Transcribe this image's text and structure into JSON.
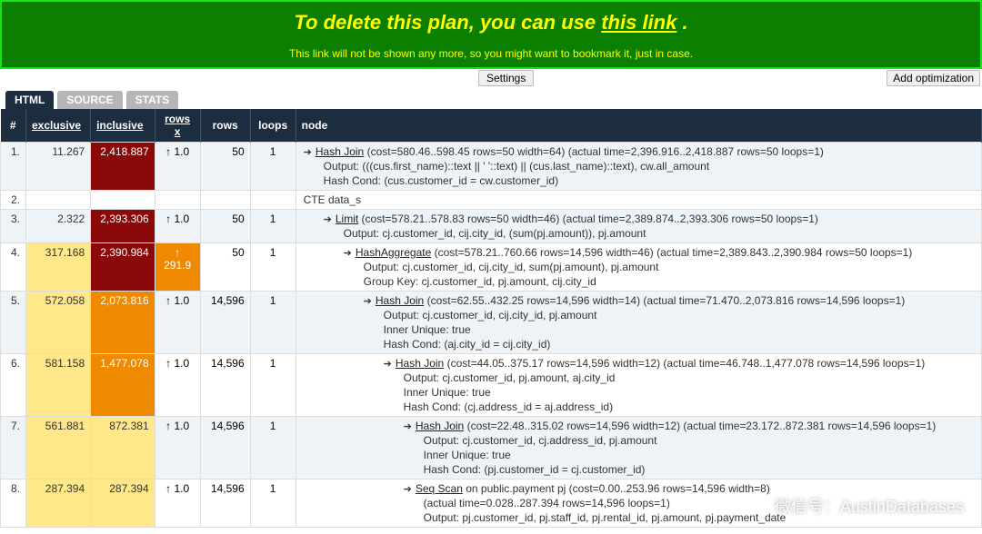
{
  "banner": {
    "title_pre": "To delete this plan, you can use ",
    "title_link": "this link",
    "title_post": ".",
    "note": "This link will not be shown any more, so you might want to bookmark it, just in case."
  },
  "buttons": {
    "settings": "Settings",
    "add_opt": "Add optimization"
  },
  "tabs": [
    {
      "label": "HTML",
      "active": true
    },
    {
      "label": "SOURCE",
      "active": false
    },
    {
      "label": "STATS",
      "active": false
    }
  ],
  "headers": {
    "idx": "#",
    "exclusive": "exclusive",
    "inclusive": "inclusive",
    "rowsx": "rows x",
    "rows": "rows",
    "loops": "loops",
    "node": "node"
  },
  "rows": [
    {
      "idx": "1.",
      "exclusive": {
        "val": "11.267",
        "hl": "hl-white"
      },
      "inclusive": {
        "val": "2,418.887",
        "hl": "hl-red"
      },
      "rowsx": "↑ 1.0",
      "rows": "50",
      "loops": "1",
      "indent": 0,
      "arrow": true,
      "name": "Hash Join",
      "stats": "  (cost=580.46..598.45 rows=50 width=64) (actual time=2,396.916..2,418.887 rows=50 loops=1)",
      "details": [
        "Output: (((cus.first_name)::text || ' '::text) || (cus.last_name)::text), cw.all_amount",
        "Hash Cond: (cus.customer_id = cw.customer_id)"
      ]
    },
    {
      "idx": "2.",
      "exclusive": {
        "val": "",
        "hl": ""
      },
      "inclusive": {
        "val": "",
        "hl": ""
      },
      "rowsx": "",
      "rows": "",
      "loops": "",
      "indent": 0,
      "arrow": false,
      "name": "",
      "stats": "CTE data_s",
      "details": []
    },
    {
      "idx": "3.",
      "exclusive": {
        "val": "2.322",
        "hl": "hl-white"
      },
      "inclusive": {
        "val": "2,393.306",
        "hl": "hl-red"
      },
      "rowsx": "↑ 1.0",
      "rows": "50",
      "loops": "1",
      "indent": 1,
      "arrow": true,
      "name": "Limit",
      "stats": "  (cost=578.21..578.83 rows=50 width=46) (actual time=2,389.874..2,393.306 rows=50 loops=1)",
      "details": [
        "Output: cj.customer_id, cij.city_id, (sum(pj.amount)), pj.amount"
      ]
    },
    {
      "idx": "4.",
      "exclusive": {
        "val": "317.168",
        "hl": "hl-yellow"
      },
      "inclusive": {
        "val": "2,390.984",
        "hl": "hl-red"
      },
      "rowsx": "↑ 291.9",
      "rowsx_hl": "hl-orange",
      "rows": "50",
      "loops": "1",
      "indent": 2,
      "arrow": true,
      "name": "HashAggregate",
      "stats": "  (cost=578.21..760.66 rows=14,596 width=46) (actual time=2,389.843..2,390.984 rows=50 loops=1)",
      "details": [
        "Output: cj.customer_id, cij.city_id, sum(pj.amount), pj.amount",
        "Group Key: cj.customer_id, pj.amount, cij.city_id"
      ]
    },
    {
      "idx": "5.",
      "exclusive": {
        "val": "572.058",
        "hl": "hl-yellow"
      },
      "inclusive": {
        "val": "2,073.816",
        "hl": "hl-orange"
      },
      "rowsx": "↑ 1.0",
      "rows": "14,596",
      "loops": "1",
      "indent": 3,
      "arrow": true,
      "name": "Hash Join",
      "stats": "  (cost=62.55..432.25 rows=14,596 width=14) (actual time=71.470..2,073.816 rows=14,596 loops=1)",
      "details": [
        "Output: cj.customer_id, cij.city_id, pj.amount",
        "Inner Unique: true",
        "Hash Cond: (aj.city_id = cij.city_id)"
      ]
    },
    {
      "idx": "6.",
      "exclusive": {
        "val": "581.158",
        "hl": "hl-yellow"
      },
      "inclusive": {
        "val": "1,477.078",
        "hl": "hl-orange"
      },
      "rowsx": "↑ 1.0",
      "rows": "14,596",
      "loops": "1",
      "indent": 4,
      "arrow": true,
      "name": "Hash Join",
      "stats": "  (cost=44.05..375.17 rows=14,596 width=12) (actual time=46.748..1,477.078 rows=14,596 loops=1)",
      "details": [
        "Output: cj.customer_id, pj.amount, aj.city_id",
        "Inner Unique: true",
        "Hash Cond: (cj.address_id = aj.address_id)"
      ]
    },
    {
      "idx": "7.",
      "exclusive": {
        "val": "561.881",
        "hl": "hl-yellow"
      },
      "inclusive": {
        "val": "872.381",
        "hl": "hl-yellow"
      },
      "rowsx": "↑ 1.0",
      "rows": "14,596",
      "loops": "1",
      "indent": 5,
      "arrow": true,
      "name": "Hash Join",
      "stats": "  (cost=22.48..315.02 rows=14,596 width=12) (actual time=23.172..872.381 rows=14,596 loops=1)",
      "details": [
        "Output: cj.customer_id, cj.address_id, pj.amount",
        "Inner Unique: true",
        "Hash Cond: (pj.customer_id = cj.customer_id)"
      ]
    },
    {
      "idx": "8.",
      "exclusive": {
        "val": "287.394",
        "hl": "hl-yellow"
      },
      "inclusive": {
        "val": "287.394",
        "hl": "hl-yellow"
      },
      "rowsx": "↑ 1.0",
      "rows": "14,596",
      "loops": "1",
      "indent": 5,
      "arrow": true,
      "name": "Seq Scan",
      "stats": "  on public.payment pj (cost=0.00..253.96 rows=14,596 width=8)",
      "stats2": "(actual time=0.028..287.394 rows=14,596 loops=1)",
      "details": [
        "Output: pj.customer_id, pj.staff_id, pj.rental_id, pj.amount, pj.payment_date"
      ]
    }
  ],
  "watermark": "微信号：AustinDatabases"
}
